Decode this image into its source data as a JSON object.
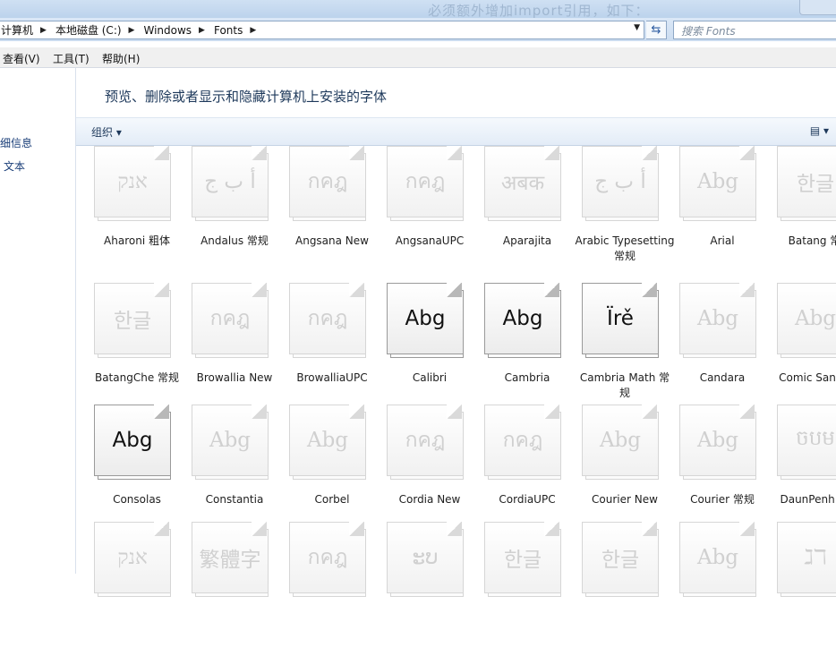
{
  "window": {
    "title_ghost": "必须额外增加import引用，如下："
  },
  "address": {
    "crumbs": [
      "计算机",
      "本地磁盘 (C:)",
      "Windows",
      "Fonts"
    ],
    "search_placeholder": "搜索 Fonts"
  },
  "menu": {
    "items": [
      "查看(V)",
      "工具(T)",
      "帮助(H)"
    ]
  },
  "sidebar": {
    "items": [
      "细信息",
      "文本"
    ]
  },
  "main": {
    "heading": "预览、删除或者显示和隐藏计算机上安装的字体",
    "organize_label": "组织 ▾",
    "view_label": "▤ ▾"
  },
  "fonts": [
    {
      "name": "Aharoni 粗体",
      "sample": "אנק",
      "active": false
    },
    {
      "name": "Andalus 常规",
      "sample": "أ ب ج",
      "active": false
    },
    {
      "name": "Angsana New",
      "sample": "กคฎ",
      "active": false
    },
    {
      "name": "AngsanaUPC",
      "sample": "กคฎ",
      "active": false
    },
    {
      "name": "Aparajita",
      "sample": "अबक",
      "active": false
    },
    {
      "name": "Arabic Typesetting 常规",
      "sample": "أ ب ج",
      "active": false
    },
    {
      "name": "Arial",
      "sample": "Abg",
      "active": false
    },
    {
      "name": "Batang 常规",
      "sample": "한글",
      "active": false
    },
    {
      "name": "BatangChe 常规",
      "sample": "한글",
      "active": false
    },
    {
      "name": "Browallia New",
      "sample": "กคฎ",
      "active": false
    },
    {
      "name": "BrowalliaUPC",
      "sample": "กคฎ",
      "active": false
    },
    {
      "name": "Calibri",
      "sample": "Abg",
      "active": true
    },
    {
      "name": "Cambria",
      "sample": "Abg",
      "active": true
    },
    {
      "name": "Cambria Math 常规",
      "sample": "Ïrě",
      "active": true
    },
    {
      "name": "Candara",
      "sample": "Abg",
      "active": false
    },
    {
      "name": "Comic Sans MS",
      "sample": "Abg",
      "active": false
    },
    {
      "name": "Consolas",
      "sample": "Abg",
      "active": true
    },
    {
      "name": "Constantia",
      "sample": "Abg",
      "active": false
    },
    {
      "name": "Corbel",
      "sample": "Abg",
      "active": false
    },
    {
      "name": "Cordia New",
      "sample": "กคฎ",
      "active": false
    },
    {
      "name": "CordiaUPC",
      "sample": "กคฎ",
      "active": false
    },
    {
      "name": "Courier New",
      "sample": "Abg",
      "active": false
    },
    {
      "name": "Courier 常规",
      "sample": "Abg",
      "active": false
    },
    {
      "name": "DaunPenh 常规",
      "sample": "ចបម",
      "active": false
    },
    {
      "name": "",
      "sample": "אנק",
      "active": false
    },
    {
      "name": "",
      "sample": "繁體字",
      "active": false
    },
    {
      "name": "",
      "sample": "กคฎ",
      "active": false
    },
    {
      "name": "",
      "sample": "ະບ",
      "active": false
    },
    {
      "name": "",
      "sample": "한글",
      "active": false
    },
    {
      "name": "",
      "sample": "한글",
      "active": false
    },
    {
      "name": "",
      "sample": "Abg",
      "active": false
    },
    {
      "name": "",
      "sample": "ℷℸ",
      "active": false
    }
  ]
}
